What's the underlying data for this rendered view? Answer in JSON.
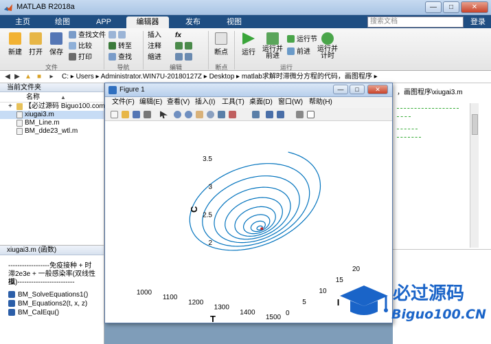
{
  "window": {
    "title": "MATLAB R2018a",
    "buttons": [
      "—",
      "□",
      "✕"
    ]
  },
  "tabs": [
    {
      "label": "主页"
    },
    {
      "label": "绘图"
    },
    {
      "label": "APP"
    },
    {
      "label": "编辑器"
    },
    {
      "label": "发布"
    },
    {
      "label": "视图"
    }
  ],
  "search": {
    "placeholder": "搜索文档"
  },
  "login_label": "登录",
  "ribbon": {
    "file": {
      "new": "新建",
      "open": "打开",
      "save": "保存",
      "find_files": "查找文件",
      "compare": "比较",
      "print": "打印",
      "group": "文件"
    },
    "navigate": {
      "goto": "转至",
      "find": "查找",
      "group": "导航"
    },
    "edit": {
      "insert": "插入",
      "comment": "注释",
      "indent": "缩进",
      "fx": "fx",
      "group": "编辑"
    },
    "breakpoints": {
      "label": "断点",
      "group": "断点"
    },
    "run": {
      "run": "运行",
      "run_advance": "运行并前进",
      "run_section": "运行节",
      "advance": "前进",
      "run_time": "运行并计时",
      "group": "运行"
    }
  },
  "path": {
    "crumbs": "C: ▸ Users ▸ Administrator.WIN7U-20180127Z ▸ Desktop ▸ matlab求解时滞微分方程的代码，画图程序 ▸"
  },
  "current_folder": {
    "title": "当前文件夹",
    "column": "名称",
    "sort_indicator": "▲",
    "files": [
      {
        "name": "【必过源码 Biguo100.com】"
      },
      {
        "name": "xiugai3.m"
      },
      {
        "name": "BM_Line.m"
      },
      {
        "name": "BM_dde23_wtl.m"
      }
    ]
  },
  "details": {
    "title": "xiugai3.m  (函数)",
    "comment_lines": [
      "------------------免疫接种 + 时",
      "滞2e3e + 一般感染率(双线性模",
      "拟)-------------------------"
    ],
    "functions": [
      {
        "name": "BM_SolveEquations1()"
      },
      {
        "name": "BM_Equations2(t, x, z)"
      },
      {
        "name": "BM_CalEqu()"
      }
    ]
  },
  "editor": {
    "path_tail": "，画图程序\\xiugai3.m"
  },
  "figure": {
    "title": "Figure 1",
    "menu": [
      "文件(F)",
      "编辑(E)",
      "查看(V)",
      "插入(I)",
      "工具(T)",
      "桌面(D)",
      "窗口(W)",
      "帮助(H)"
    ]
  },
  "watermark": {
    "text": "必过源码",
    "url": "Biguo100.CN"
  },
  "chart_data": {
    "type": "line",
    "projection": "3d",
    "title": "",
    "xlabel": "T",
    "ylabel": "I",
    "zlabel": "C",
    "xlim": [
      1000,
      1500
    ],
    "ylim": [
      0,
      20
    ],
    "zlim": [
      2,
      3.5
    ],
    "xticks": [
      1000,
      1100,
      1200,
      1300,
      1400,
      1500
    ],
    "yticks": [
      0,
      5,
      10,
      15,
      20
    ],
    "zticks": [
      2,
      2.5,
      3,
      3.5
    ],
    "series": [
      {
        "color": "#0072bd",
        "spiral": {
          "start": [
            1290,
            20,
            3.8
          ],
          "end": [
            1300,
            10,
            2.9
          ],
          "turns": 9
        }
      }
    ]
  }
}
